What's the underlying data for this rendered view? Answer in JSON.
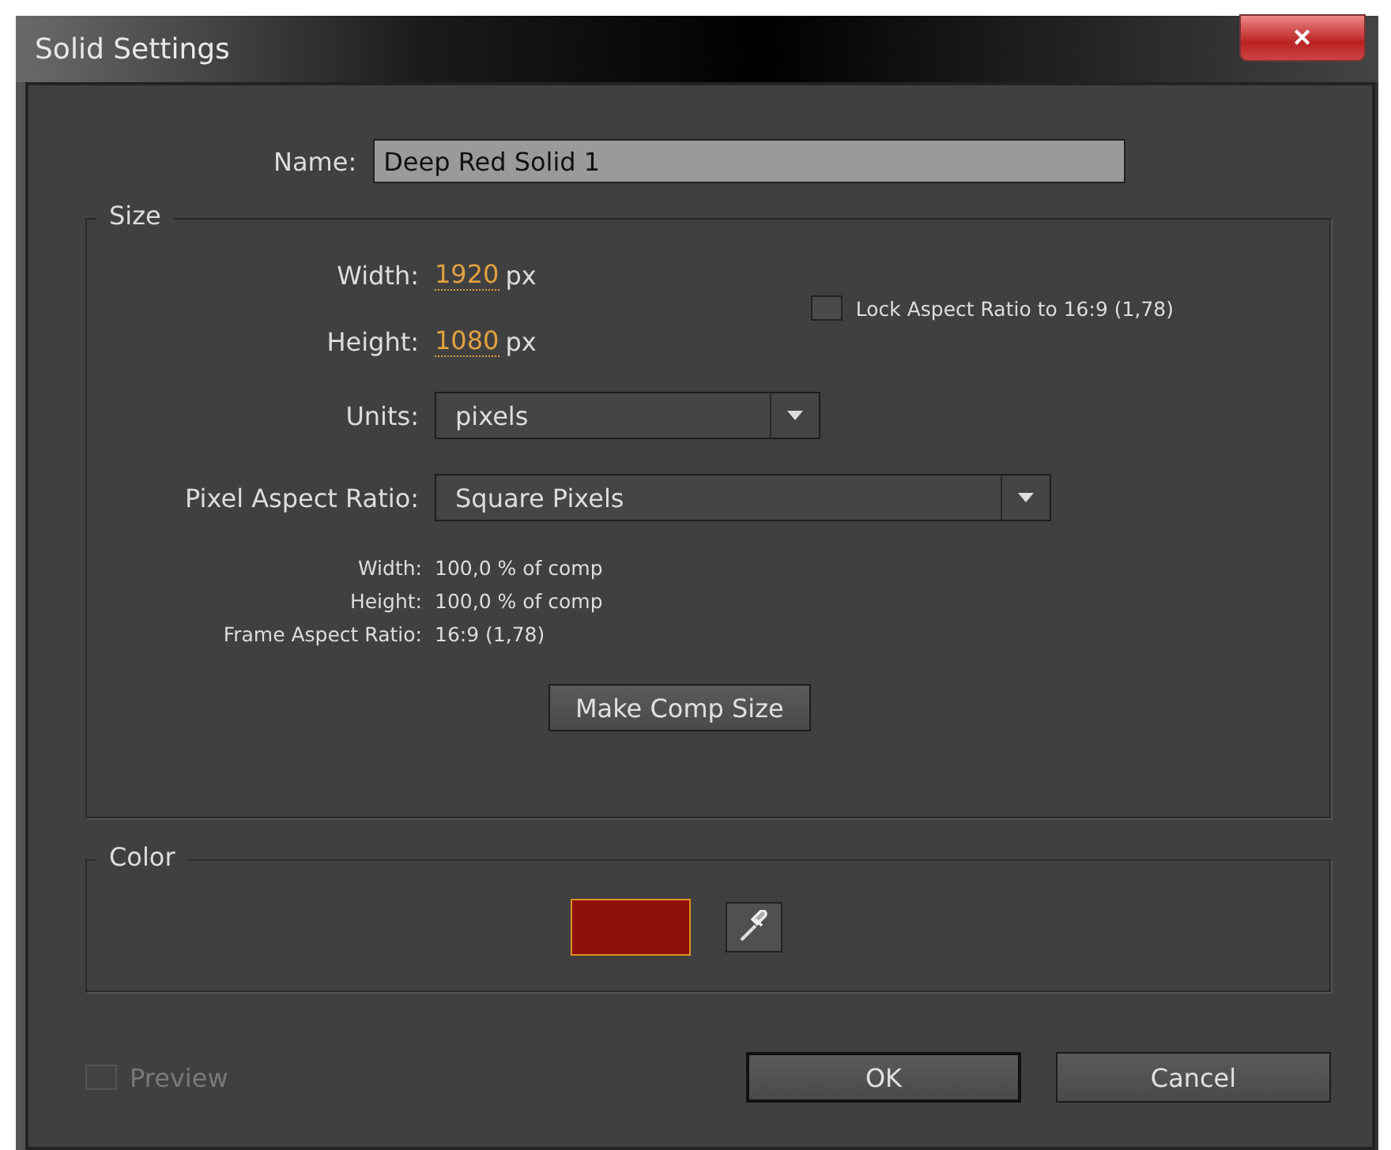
{
  "window": {
    "title": "Solid Settings",
    "close": "✕"
  },
  "name": {
    "label": "Name:",
    "value": "Deep Red Solid 1"
  },
  "size": {
    "legend": "Size",
    "width": {
      "label": "Width:",
      "value": "1920",
      "unit": "px"
    },
    "height": {
      "label": "Height:",
      "value": "1080",
      "unit": "px"
    },
    "lock": {
      "label": "Lock Aspect Ratio to 16:9 (1,78)",
      "checked": false
    },
    "units": {
      "label": "Units:",
      "value": "pixels"
    },
    "pixel_aspect": {
      "label": "Pixel Aspect Ratio:",
      "value": "Square Pixels"
    },
    "info": [
      {
        "label": "Width:",
        "value": "100,0 % of comp"
      },
      {
        "label": "Height:",
        "value": "100,0 % of comp"
      },
      {
        "label": "Frame Aspect Ratio:",
        "value": "16:9 (1,78)"
      }
    ],
    "make_comp_size": "Make Comp Size"
  },
  "color": {
    "legend": "Color",
    "color": "#8e0f0b"
  },
  "preview": {
    "label": "Preview",
    "checked": false,
    "disabled": true
  },
  "buttons": [
    {
      "label": "OK",
      "default": true
    },
    {
      "label": "Cancel",
      "default": false
    }
  ]
}
